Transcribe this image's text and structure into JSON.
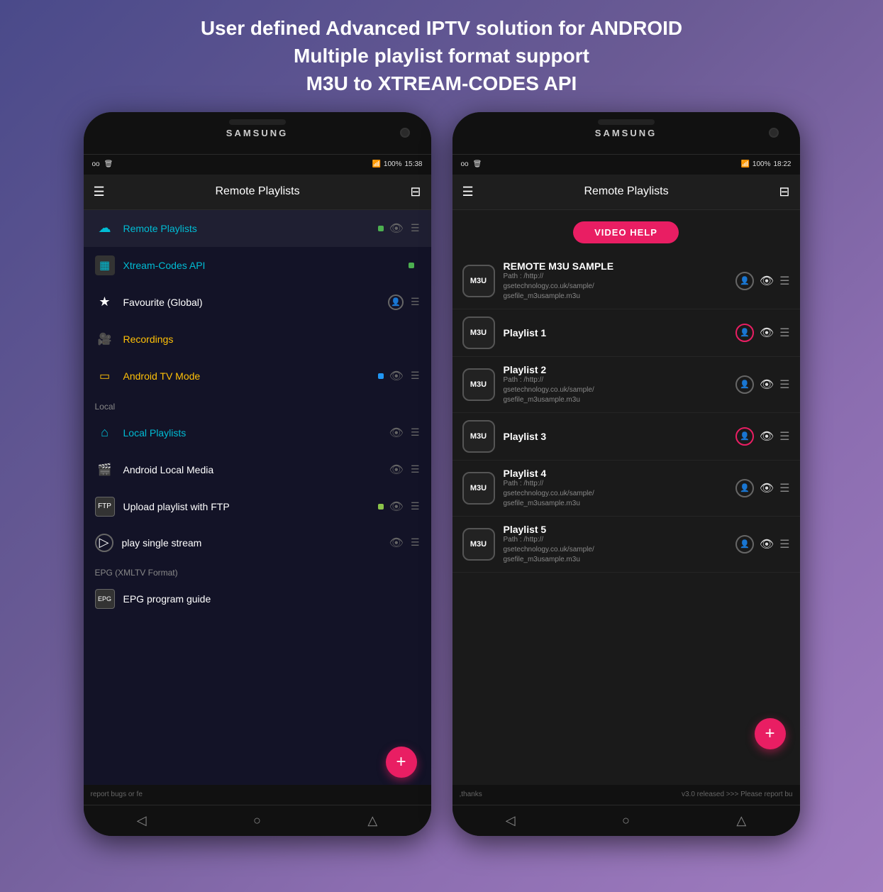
{
  "header": {
    "line1": "User defined Advanced IPTV solution for ANDROID",
    "line2": "Multiple playlist format support",
    "line3": "M3U to XTREAM-CODES API"
  },
  "phone_left": {
    "brand": "SAMSUNG",
    "status": {
      "time": "15:38",
      "battery": "100%",
      "signal": "wifi+bars"
    },
    "app_title": "Remote Playlists",
    "menu_items": [
      {
        "id": "remote-playlists",
        "icon": "☁",
        "label": "Remote Playlists",
        "color": "cyan",
        "dot": "green",
        "has_actions": true
      },
      {
        "id": "xtream-codes",
        "icon": "▦",
        "label": "Xtream-Codes API",
        "color": "cyan",
        "dot": "green",
        "has_actions": false
      },
      {
        "id": "favourite",
        "icon": "★",
        "label": "Favourite (Global)",
        "color": "white",
        "dot": null,
        "has_actions": true
      },
      {
        "id": "recordings",
        "icon": "🎥",
        "label": "Recordings",
        "color": "yellow",
        "dot": null,
        "has_actions": false
      },
      {
        "id": "android-tv",
        "icon": "▭",
        "label": "Android TV Mode",
        "color": "yellow",
        "dot": "blue",
        "has_actions": true
      }
    ],
    "section_local": "Local",
    "local_items": [
      {
        "id": "local-playlists",
        "icon": "⌂",
        "label": "Local Playlists",
        "color": "cyan",
        "has_actions": true
      },
      {
        "id": "android-media",
        "icon": "🎬",
        "label": "Android Local Media",
        "color": "white",
        "has_actions": true
      },
      {
        "id": "ftp-upload",
        "icon": "FTP",
        "label": "Upload playlist with FTP",
        "color": "white",
        "dot": "lime",
        "has_actions": true
      },
      {
        "id": "single-stream",
        "icon": "▷",
        "label": "play single stream",
        "color": "white",
        "has_actions": true
      }
    ],
    "section_epg": "EPG (XMLTV Format)",
    "epg_items": [
      {
        "id": "epg-guide",
        "icon": "EPG",
        "label": "EPG program guide",
        "color": "white"
      }
    ],
    "footer": "report bugs or fe",
    "fab_label": "+"
  },
  "phone_right": {
    "brand": "SAMSUNG",
    "status": {
      "time": "18:22",
      "battery": "100%"
    },
    "app_title": "Remote Playlists",
    "video_help_label": "VIDEO HELP",
    "playlists": [
      {
        "id": "p1",
        "badge": "M3U",
        "name": "REMOTE M3U SAMPLE",
        "path": "Path : /http://gsetechnology.co.uk/sample/gsefile_m3usample.m3u",
        "person_pink": false,
        "eye_active": true
      },
      {
        "id": "p2",
        "badge": "M3U",
        "name": "Playlist 1",
        "path": "",
        "person_pink": true,
        "eye_active": true
      },
      {
        "id": "p3",
        "badge": "M3U",
        "name": "Playlist 2",
        "path": "Path : /http://gsetechnology.co.uk/sample/gsefile_m3usample.m3u",
        "person_pink": false,
        "eye_active": true
      },
      {
        "id": "p4",
        "badge": "M3U",
        "name": "Playlist 3",
        "path": "",
        "person_pink": true,
        "eye_active": true
      },
      {
        "id": "p5",
        "badge": "M3U",
        "name": "Playlist 4",
        "path": "Path : /http://gsetechnology.co.uk/sample/gsefile_m3usample.m3u",
        "person_pink": false,
        "eye_active": true
      },
      {
        "id": "p6",
        "badge": "M3U",
        "name": "Playlist 5",
        "path": "Path : /http://gsetechnology.co.uk/sample/gsefile_m3usample.m3u",
        "person_pink": false,
        "eye_active": true
      }
    ],
    "footer_left": ",thanks",
    "footer_right": "v3.0 released >>> Please report bu",
    "fab_label": "+"
  }
}
